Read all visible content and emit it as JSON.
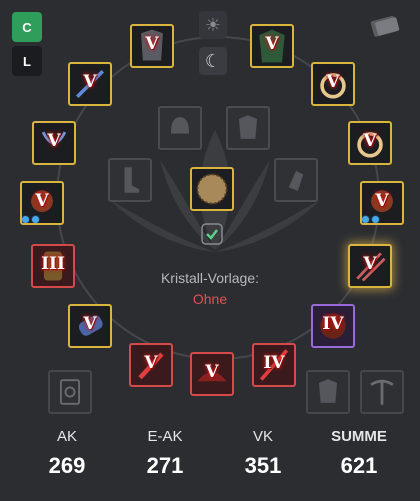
{
  "buttons": {
    "c_label": "C",
    "l_label": "L"
  },
  "crystal": {
    "label": "Kristall-Vorlage:",
    "value": "Ohne"
  },
  "slots": {
    "head": "V",
    "upper_right": "V",
    "left_1": "V",
    "right_1": "V",
    "left_2": "V",
    "right_2": "V",
    "left_3": "V",
    "right_3": "V",
    "left_4": "III",
    "right_4": "V",
    "left_5": "V",
    "right_5": "IV",
    "bottom_left": "V",
    "bottom_center": "V",
    "bottom_right": "IV"
  },
  "stats": [
    {
      "label": "AK",
      "value": "269"
    },
    {
      "label": "E-AK",
      "value": "271"
    },
    {
      "label": "VK",
      "value": "351"
    },
    {
      "label": "SUMME",
      "value": "621"
    }
  ],
  "colors": {
    "gold": "#d9b43e",
    "red": "#d44a4a",
    "purple": "#9a6ad8",
    "green": "#2f9e5b",
    "error_text": "#e05252"
  }
}
